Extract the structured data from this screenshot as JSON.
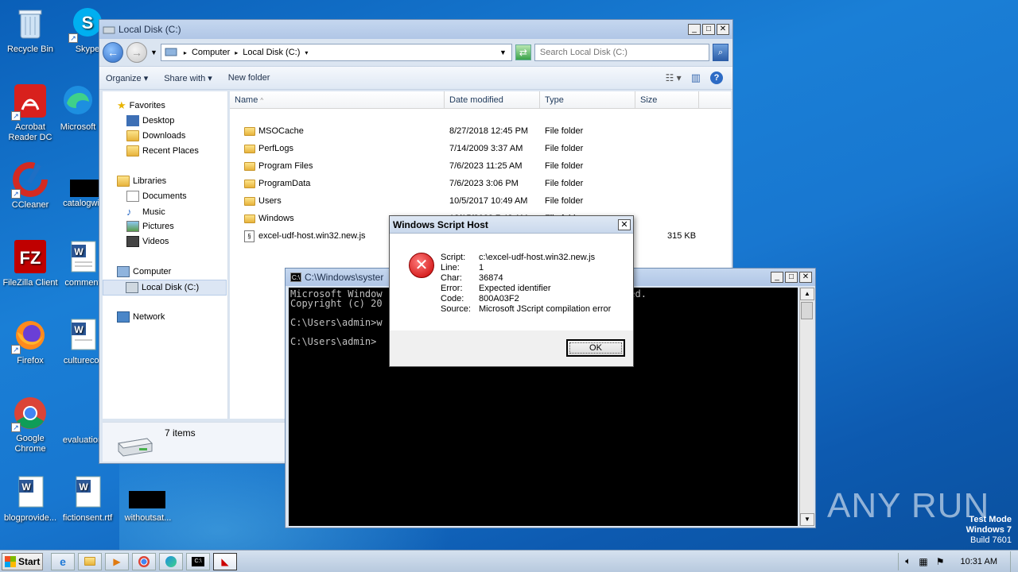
{
  "desktop_icons": [
    {
      "label": "Recycle Bin",
      "icon": "recycle-bin-icon"
    },
    {
      "label": "Skype",
      "icon": "skype-icon"
    },
    {
      "label": "Acrobat Reader DC",
      "icon": "acrobat-icon"
    },
    {
      "label": "Microsoft",
      "icon": "edge-icon"
    },
    {
      "label": "CCleaner",
      "icon": "ccleaner-icon"
    },
    {
      "label": "catalogwi",
      "icon": "document-icon"
    },
    {
      "label": "FileZilla Client",
      "icon": "filezilla-icon"
    },
    {
      "label": "comment",
      "icon": "word-icon"
    },
    {
      "label": "Firefox",
      "icon": "firefox-icon"
    },
    {
      "label": "culturecor",
      "icon": "word-icon"
    },
    {
      "label": "Google Chrome",
      "icon": "chrome-icon"
    },
    {
      "label": "evaluation",
      "icon": "document-icon"
    },
    {
      "label": "blogprovide...",
      "icon": "word-icon"
    },
    {
      "label": "fictionsent.rtf",
      "icon": "word-icon"
    },
    {
      "label": "withoutsat...",
      "icon": "document-icon"
    }
  ],
  "explorer": {
    "title": "Local Disk (C:)",
    "breadcrumb": [
      "Computer",
      "Local Disk (C:)"
    ],
    "search_placeholder": "Search Local Disk (C:)",
    "commands": [
      "Organize",
      "Share with",
      "New folder"
    ],
    "nav": {
      "favorites": "Favorites",
      "favorites_items": [
        "Desktop",
        "Downloads",
        "Recent Places"
      ],
      "libraries": "Libraries",
      "libraries_items": [
        "Documents",
        "Music",
        "Pictures",
        "Videos"
      ],
      "computer": "Computer",
      "computer_items": [
        "Local Disk (C:)"
      ],
      "network": "Network"
    },
    "columns": [
      "Name",
      "Date modified",
      "Type",
      "Size"
    ],
    "rows": [
      {
        "name": "MSOCache",
        "date": "8/27/2018 12:45 PM",
        "type": "File folder",
        "size": ""
      },
      {
        "name": "PerfLogs",
        "date": "7/14/2009 3:37 AM",
        "type": "File folder",
        "size": ""
      },
      {
        "name": "Program Files",
        "date": "7/6/2023 11:25 AM",
        "type": "File folder",
        "size": ""
      },
      {
        "name": "ProgramData",
        "date": "7/6/2023 3:06 PM",
        "type": "File folder",
        "size": ""
      },
      {
        "name": "Users",
        "date": "10/5/2017 10:49 AM",
        "type": "File folder",
        "size": ""
      },
      {
        "name": "Windows",
        "date": "12/15/2023 7:48 AM",
        "type": "File folder",
        "size": ""
      },
      {
        "name": "excel-udf-host.win32.new.js",
        "date": "",
        "type": "",
        "size": "315 KB"
      }
    ],
    "status": "7 items"
  },
  "cmd": {
    "title": "C:\\Windows\\syster",
    "lines": [
      "Microsoft Window                                     reserved.",
      "Copyright (c) 20",
      "",
      "C:\\Users\\admin>w                                   .js",
      "",
      "C:\\Users\\admin>"
    ]
  },
  "dialog": {
    "title": "Windows Script Host",
    "fields": [
      {
        "label": "Script:",
        "value": "c:\\excel-udf-host.win32.new.js"
      },
      {
        "label": "Line:",
        "value": "1"
      },
      {
        "label": "Char:",
        "value": "36874"
      },
      {
        "label": "Error:",
        "value": "Expected identifier"
      },
      {
        "label": "Code:",
        "value": "800A03F2"
      },
      {
        "label": "Source:",
        "value": "Microsoft JScript compilation error"
      }
    ],
    "ok_label": "OK"
  },
  "taskbar": {
    "start_label": "Start",
    "clock": "10:31 AM"
  },
  "watermark": {
    "line1": "Test Mode",
    "line2": "Windows 7",
    "line3": "Build 7601",
    "brand": "ANY RUN"
  }
}
